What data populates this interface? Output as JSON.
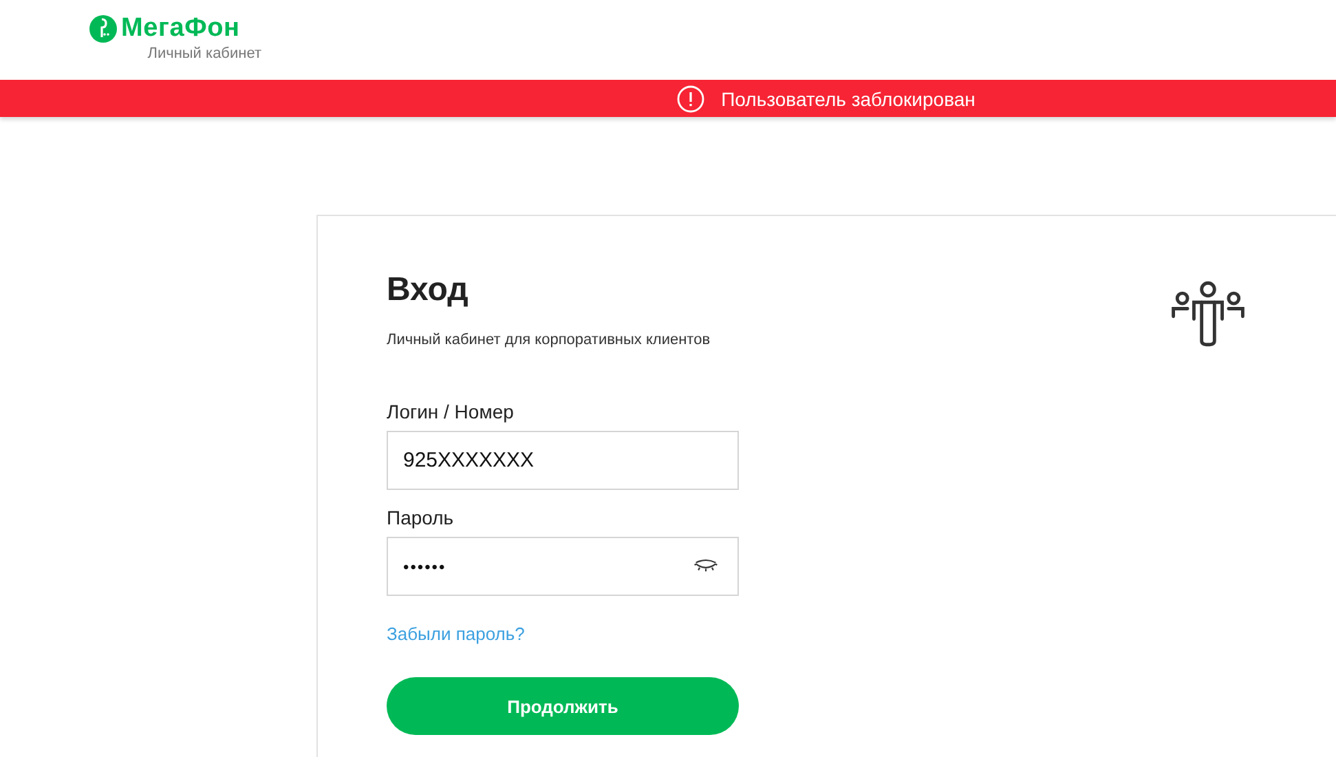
{
  "header": {
    "brand": "МегаФон",
    "subtitle": "Личный кабинет"
  },
  "alert": {
    "message": "Пользователь заблокирован"
  },
  "login": {
    "title": "Вход",
    "subtitle": "Личный кабинет для корпоративных клиентов",
    "fields": [
      {
        "label": "Логин / Номер",
        "value": "925XXXXXXX",
        "kind": "text"
      },
      {
        "label": "Пароль",
        "value": "••••••",
        "kind": "password"
      }
    ],
    "forgot_link": "Забыли пароль?",
    "submit": "Продолжить"
  }
}
